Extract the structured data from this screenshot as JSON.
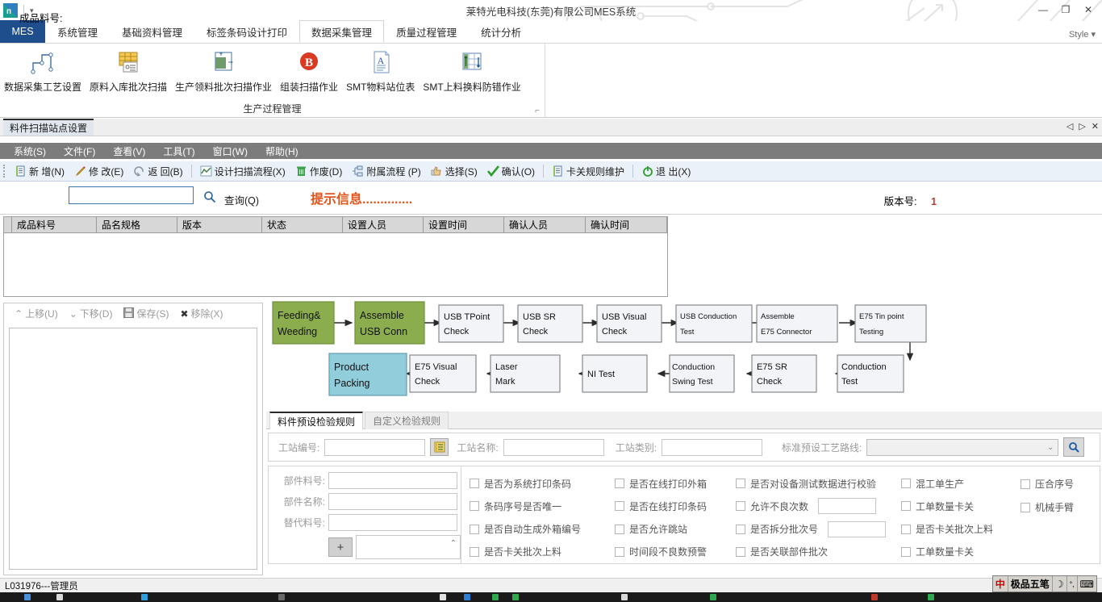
{
  "window": {
    "title": "莱特光电科技(东莞)有限公司MES系统",
    "qat_dropdown": "▾",
    "minimize": "—",
    "maximize": "❐",
    "close": "✕",
    "style_menu": "Style"
  },
  "ribbon": {
    "tabs": [
      {
        "label": "MES",
        "active": false,
        "brand": true
      },
      {
        "label": "系统管理",
        "active": false
      },
      {
        "label": "基础资料管理",
        "active": false
      },
      {
        "label": "标签条码设计打印",
        "active": false
      },
      {
        "label": "数据采集管理",
        "active": true
      },
      {
        "label": "质量过程管理",
        "active": false
      },
      {
        "label": "统计分析",
        "active": false
      }
    ],
    "group_title": "生产过程管理",
    "group_launcher": "⌐",
    "items": [
      {
        "label": "数据采集工艺设置",
        "icon": "flow-node-icon"
      },
      {
        "label": "原料入库批次扫描",
        "icon": "table-scan-icon"
      },
      {
        "label": "生产领料批次扫描作业",
        "icon": "material-issue-icon"
      },
      {
        "label": "组装扫描作业",
        "icon": "barcode-b-icon"
      },
      {
        "label": "SMT物料站位表",
        "icon": "document-a-icon"
      },
      {
        "label": "SMT上料换料防错作业",
        "icon": "grid-updown-icon"
      }
    ]
  },
  "mdi": {
    "tab_label": "料件扫描站点设置",
    "nav_prev": "◁",
    "nav_next": "▷",
    "nav_close": "✕"
  },
  "menubar": {
    "items": [
      "系统(S)",
      "文件(F)",
      "查看(V)",
      "工具(T)",
      "窗口(W)",
      "帮助(H)"
    ]
  },
  "toolbar": {
    "buttons": [
      {
        "label": "新 增(N)",
        "icon": "new-document-icon"
      },
      {
        "label": "修 改(E)",
        "icon": "pencil-icon"
      },
      {
        "label": "返 回(B)",
        "icon": "undo-icon"
      },
      {
        "label": "设计扫描流程(X)",
        "icon": "chart-design-icon"
      },
      {
        "label": "作废(D)",
        "icon": "trash-icon"
      },
      {
        "label": "附属流程 (P)",
        "icon": "branch-icon"
      },
      {
        "label": "选择(S)",
        "icon": "thumb-icon"
      },
      {
        "label": "确认(O)",
        "icon": "check-icon"
      },
      {
        "label": "卡关规则维护",
        "icon": "rules-icon"
      },
      {
        "label": "退 出(X)",
        "icon": "power-icon"
      }
    ]
  },
  "query": {
    "label": "成品料号:",
    "value": "",
    "placeholder": "",
    "search_icon": "magnifier-icon",
    "button": "查询(Q)",
    "hint": "提示信息..............",
    "version_label": "版本号:",
    "version_value": "1"
  },
  "grid": {
    "columns": [
      "成品料号",
      "品名规格",
      "版本",
      "状态",
      "设置人员",
      "设置时间",
      "确认人员",
      "确认时间"
    ],
    "rows": []
  },
  "left_panel": {
    "buttons": [
      {
        "label": "上移(U)",
        "icon": "chevron-up-icon",
        "enabled": false
      },
      {
        "label": "下移(D)",
        "icon": "chevron-down-icon",
        "enabled": false
      },
      {
        "label": "保存(S)",
        "icon": "save-icon",
        "enabled": false
      },
      {
        "label": "移除(X)",
        "icon": "close-x-icon",
        "enabled": false
      }
    ],
    "list_items": []
  },
  "flow_chart": {
    "colors": {
      "green": "#8cad4e",
      "blue": "#92cddc",
      "plain": "#f2f4f8",
      "border": "#7f7f7f",
      "green_border": "#6f8f3c",
      "blue_border": "#5d9cb5"
    },
    "row1": [
      {
        "lines": [
          "Feeding&",
          "Weeding"
        ],
        "style": "green"
      },
      {
        "lines": [
          "Assemble",
          "USB Conn"
        ],
        "style": "green"
      },
      {
        "lines": [
          "USB TPoint",
          "Check"
        ],
        "style": "plain"
      },
      {
        "lines": [
          "USB SR",
          "Check"
        ],
        "style": "plain"
      },
      {
        "lines": [
          "USB Visual",
          "Check"
        ],
        "style": "plain"
      },
      {
        "lines": [
          "USB Conduction",
          "Test"
        ],
        "style": "plain"
      },
      {
        "lines": [
          "Assemble",
          "E75 Connector"
        ],
        "style": "plain"
      },
      {
        "lines": [
          "E75 Tin point",
          "Testing"
        ],
        "style": "plain"
      }
    ],
    "row2": [
      {
        "lines": [
          "Product",
          "Packing"
        ],
        "style": "blue"
      },
      {
        "lines": [
          "E75 Visual",
          "Check"
        ],
        "style": "plain"
      },
      {
        "lines": [
          "Laser",
          "Mark"
        ],
        "style": "plain"
      },
      {
        "lines": [
          "NI Test"
        ],
        "style": "plain"
      },
      {
        "lines": [
          "Conduction",
          "Swing Test"
        ],
        "style": "plain"
      },
      {
        "lines": [
          "E75 SR",
          "Check"
        ],
        "style": "plain"
      },
      {
        "lines": [
          "Conduction",
          "Test"
        ],
        "style": "plain"
      }
    ]
  },
  "bottom_panel": {
    "tabs": [
      {
        "label": "料件预设检验规则",
        "active": true
      },
      {
        "label": "自定义检验规则",
        "active": false
      }
    ],
    "filters": [
      {
        "label": "工站编号:",
        "value": ""
      },
      {
        "label": "工站名称:",
        "value": ""
      },
      {
        "label": "工站类别:",
        "value": ""
      }
    ],
    "picker_icon": "list-picker-icon",
    "route_label": "标准预设工艺路线:",
    "route_value": "",
    "search_icon": "magnifier-icon",
    "form_fields": [
      {
        "label": "部件料号:",
        "value": ""
      },
      {
        "label": "部件名称:",
        "value": ""
      },
      {
        "label": "替代料号:",
        "value": ""
      }
    ],
    "add_button": "+",
    "spin_value": "",
    "checkbox_columns": [
      [
        {
          "label": "是否为系统打印条码",
          "checked": false
        },
        {
          "label": "条码序号是否唯一",
          "checked": false
        },
        {
          "label": "是否自动生成外箱编号",
          "checked": false
        },
        {
          "label": "是否卡关批次上料",
          "checked": false
        }
      ],
      [
        {
          "label": "是否在线打印外箱",
          "checked": false
        },
        {
          "label": "是否在线打印条码",
          "checked": false
        },
        {
          "label": "是否允许跳站",
          "checked": false
        },
        {
          "label": "时间段不良数预警",
          "checked": false
        }
      ],
      [
        {
          "label": "是否对设备测试数据进行校验",
          "checked": false
        },
        {
          "label": "允许不良次数",
          "checked": false,
          "input": ""
        },
        {
          "label": "是否拆分批次号",
          "checked": false,
          "input": ""
        },
        {
          "label": "是否关联部件批次",
          "checked": false
        }
      ],
      [
        {
          "label": "混工单生产",
          "checked": false
        },
        {
          "label": "工单数量卡关",
          "checked": false
        },
        {
          "label": "是否卡关批次上料",
          "checked": false
        },
        {
          "label": "工单数量卡关",
          "checked": false
        }
      ],
      [
        {
          "label": "压合序号",
          "checked": false
        },
        {
          "label": "机械手臂",
          "checked": false
        }
      ]
    ]
  },
  "statusbar": {
    "user": "L031976---管理员"
  },
  "ime": {
    "mode": "中",
    "name": "极品五笔",
    "moon": "☽",
    "punct": "°,",
    "keyboard": "⌨"
  }
}
